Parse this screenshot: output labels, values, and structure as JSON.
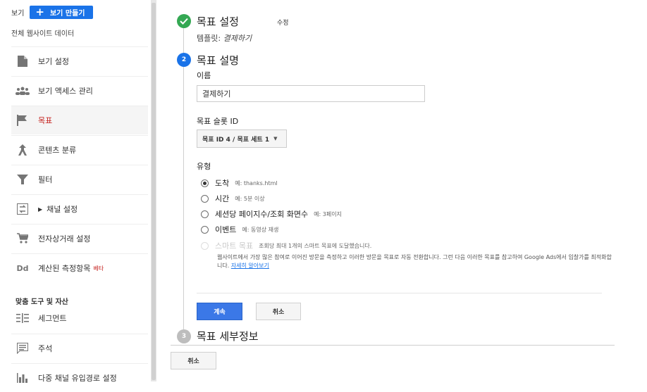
{
  "sidebar": {
    "view_label": "보기",
    "create_view_label": "보기 만들기",
    "subtitle": "전체 웹사이트 데이터",
    "items": [
      {
        "label": "보기 설정",
        "icon": "document-icon"
      },
      {
        "label": "보기 액세스 관리",
        "icon": "people-icon"
      },
      {
        "label": "목표",
        "icon": "flag-icon"
      },
      {
        "label": "콘텐츠 분류",
        "icon": "grouping-icon"
      },
      {
        "label": "필터",
        "icon": "filter-icon"
      },
      {
        "label": "채널 설정",
        "icon": "channel-settings-icon"
      },
      {
        "label": "전자상거래 설정",
        "icon": "cart-icon"
      },
      {
        "label": "계산된 측정항목",
        "icon": "dd-icon",
        "badge": "베타"
      }
    ],
    "section_title": "맞춤 도구 및 자산",
    "tool_items": [
      {
        "label": "세그먼트",
        "icon": "segment-icon"
      },
      {
        "label": "주석",
        "icon": "comment-icon"
      },
      {
        "label": "다중 채널 유입경로 설정",
        "icon": "bar-chart-icon"
      }
    ]
  },
  "steps": {
    "setup": {
      "title": "목표 설정",
      "edit_label": "수정",
      "template_label": "템플릿:",
      "template_value": "결제하기"
    },
    "description": {
      "number": "2",
      "title": "목표 설명",
      "name_label": "이름",
      "name_value": "결제하기",
      "slot_label": "목표 슬롯 ID",
      "slot_value": "목표 ID 4 / 목표 세트 1",
      "type_label": "유형",
      "types": [
        {
          "label": "도착",
          "hint": "예: thanks.html"
        },
        {
          "label": "시간",
          "hint": "예: 5분 이상"
        },
        {
          "label": "세션당 페이지수/조회 화면수",
          "hint": "예: 3페이지"
        },
        {
          "label": "이벤트",
          "hint": "예: 동영상 재생"
        },
        {
          "label": "스마트 목표",
          "hint": "조회당 최대 1개의 스마트 목표에 도달했습니다."
        }
      ],
      "smart_desc": "웹사이트에서 가장 많은 참여로 이어진 방문을 측정하고 이러한 방문을 목표로 자동 전환합니다. 그런 다음 이러한 목표를 참고하여 Google Ads에서 입찰가를 최적화합니다.",
      "learn_more": "자세히 알아보기",
      "continue_label": "계속",
      "cancel_label": "취소"
    },
    "details": {
      "number": "3",
      "title": "목표 세부정보"
    }
  },
  "footer": {
    "cancel_label": "취소"
  },
  "colors": {
    "accent": "#1a73e8",
    "check": "#34a853",
    "active_text": "#c5221f",
    "step_gray": "#bdbdbd"
  }
}
